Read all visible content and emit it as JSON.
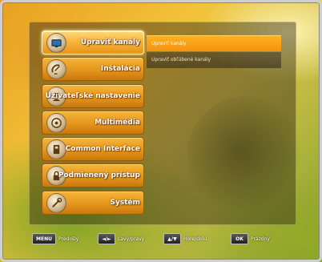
{
  "menu": {
    "items": [
      {
        "label": "Upraviť kanály",
        "icon": "tv-icon",
        "active": true
      },
      {
        "label": "Inštalácia",
        "icon": "satellite-dish-icon",
        "active": false
      },
      {
        "label": "Užívateľské nastavenie",
        "icon": "user-settings-icon",
        "active": false
      },
      {
        "label": "Multimédia",
        "icon": "disc-icon",
        "active": false
      },
      {
        "label": "Common Interface",
        "icon": "ci-card-icon",
        "active": false
      },
      {
        "label": "Podmienený prístup",
        "icon": "lock-icon",
        "active": false
      },
      {
        "label": "Systém",
        "icon": "tools-icon",
        "active": false
      }
    ]
  },
  "submenu": {
    "items": [
      {
        "label": "Upraviť kanály",
        "active": true
      },
      {
        "label": "Upraviť obľúbené kanály",
        "active": false
      }
    ]
  },
  "footer": {
    "menu_key": "MENU",
    "menu_label": "Predošlý",
    "lr_key": "◄/►",
    "lr_label": "Ľavý/pravý",
    "ud_key": "▲/▼",
    "ud_label": "Hore/dolu",
    "ok_key": "OK",
    "ok_label": "Prázdny"
  },
  "colors": {
    "menu_item": "#e5961b",
    "submenu_active": "#f39410"
  }
}
